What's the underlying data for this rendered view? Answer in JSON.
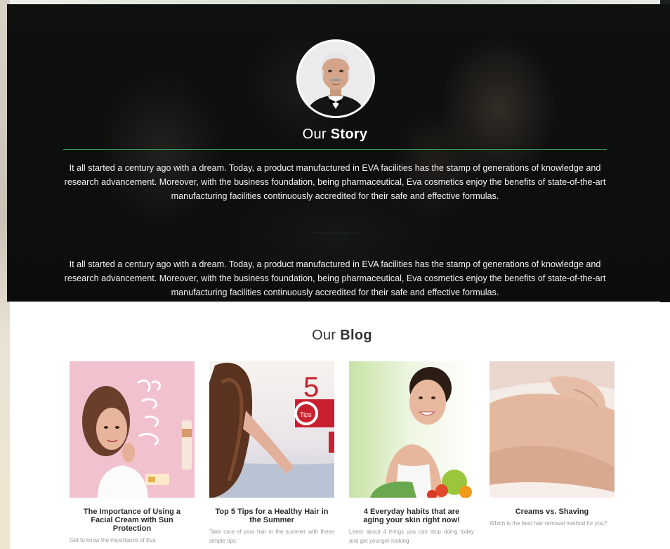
{
  "story": {
    "title_light": "Our ",
    "title_bold": "Story",
    "paragraph_1": "It all started a century ago with a dream. Today, a product manufactured in EVA facilities has the stamp of generations of knowledge and research advancement. Moreover, with the business foundation, being pharmaceutical, Eva cosmetics enjoy the benefits of state-of-the-art manufacturing facilities continuously accredited for their safe and effective formulas.",
    "paragraph_2": "It all started a century ago with a dream. Today, a product manufactured in EVA facilities has the stamp of generations of knowledge and research advancement. Moreover, with the business foundation, being pharmaceutical, Eva cosmetics enjoy the benefits of state-of-the-art manufacturing facilities continuously accredited for their safe and effective formulas."
  },
  "blog": {
    "title_light": "Our ",
    "title_bold": "Blog",
    "posts": [
      {
        "title": "The Importance of Using a Facial Cream with Sun Protection",
        "excerpt": "Get to know the importance of Eva"
      },
      {
        "title": "Top 5 Tips for a Healthy Hair in the Summer",
        "excerpt": "Take care of your hair in the summer with these simple tips."
      },
      {
        "title": "4 Everyday habits that are aging your skin right now!",
        "excerpt": "Learn about 4 things you can stop doing today and get younger looking"
      },
      {
        "title": "Creams vs. Shaving",
        "excerpt": "Which is the best hair removal method for you?"
      }
    ]
  },
  "colors": {
    "accent_green": "#3aa35a",
    "story_bg": "#101412",
    "blog_title": "#333333",
    "excerpt_gray": "#9a9a9a"
  }
}
